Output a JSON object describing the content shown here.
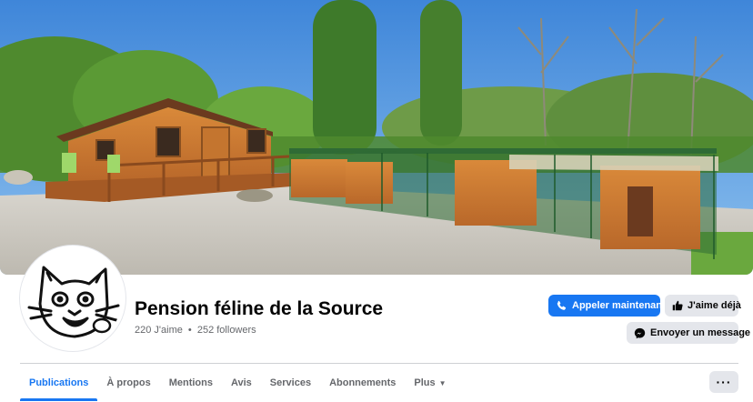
{
  "page": {
    "name": "Pension féline de la Source",
    "likes": "220 J'aime",
    "followers": "252 followers",
    "separator": "•"
  },
  "actions": {
    "call": "Appeler maintenant",
    "like": "J'aime déjà",
    "message": "Envoyer un message"
  },
  "tabs": [
    {
      "label": "Publications",
      "active": true
    },
    {
      "label": "À propos"
    },
    {
      "label": "Mentions"
    },
    {
      "label": "Avis"
    },
    {
      "label": "Services"
    },
    {
      "label": "Abonnements"
    },
    {
      "label": "Plus",
      "icon": "caret-down-icon"
    }
  ],
  "more_menu": {
    "label": "···",
    "icon": "ellipsis-icon"
  },
  "colors": {
    "accent": "#1877f2",
    "button_secondary": "#e4e6eb",
    "text_secondary": "#65676b"
  }
}
